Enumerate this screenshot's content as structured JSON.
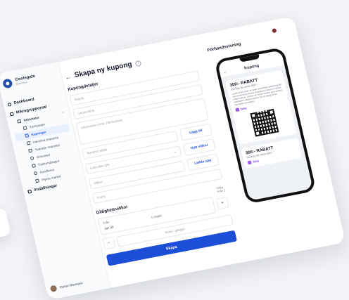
{
  "brand": {
    "name": "Coolegate",
    "sub": "Business"
  },
  "sidebar": {
    "items": [
      {
        "label": "Dashboard",
        "level": "top"
      },
      {
        "label": "Mikrogrupporsal",
        "level": "top"
      },
      {
        "label": "Aktiviteter",
        "level": "sub1"
      },
      {
        "label": "Kampanjer",
        "level": "sub2"
      },
      {
        "label": "Kuponger",
        "level": "sub2",
        "active": true
      },
      {
        "label": "Inkomna requests",
        "level": "sub2"
      },
      {
        "label": "Svarade requests",
        "level": "sub2"
      },
      {
        "label": "Annonser",
        "level": "sub2"
      },
      {
        "label": "Fasbundslagor",
        "level": "sub2"
      },
      {
        "label": "Kundkrets",
        "level": "sub2"
      },
      {
        "label": "Flyers market",
        "level": "sub2"
      },
      {
        "label": "Inställningar",
        "level": "top"
      }
    ],
    "user": "Stefan Rivensen"
  },
  "form": {
    "title": "Skapa ny kupong",
    "section_details": "Kupongdetaljer",
    "rubrik_placeholder": "Rubrik",
    "underrubrik_placeholder": "Underrubrik",
    "info_placeholder": "Information (max 200 tecken)",
    "rabatt_placeholder": "Summa rabatt",
    "add_link": "Lägg till",
    "ean_placeholder": "EAN eller QR",
    "terms_link": "Nytt villkor",
    "villkor_placeholder": "Villkor",
    "upload_link": "Ladda upp",
    "code_placeholder": "Kod:0",
    "section_validity": "Giltighetsvillkor",
    "validity_label": "Giltig",
    "validity_value": "Från 1",
    "period_from_label": "Från",
    "period_from_value": "Jan 20",
    "period_days": "0 dagar",
    "unlimited_placeholder": "Antal / gånger",
    "submit": "Skapa"
  },
  "preview": {
    "label": "Förhandsvisning",
    "header": "Kupong",
    "coupon1": {
      "title": "300:- RABATT",
      "sub": "Vid köp för minst 600:-",
      "text": "Lorem ipsum dolor sit amet consectetur adipiscing elit sed do eiusmod tempor incididunt ut labore et dolore magna aliqua. Ut enim ad minim veniam quis nostrud exercitation ullamco laboris nisi ut aliquip ex ea commodo consequat.",
      "brand": "Telia"
    },
    "coupon2": {
      "title": "300:- RABATT",
      "sub": "Vid köp för minst 600:-",
      "brand": "Telia"
    }
  }
}
